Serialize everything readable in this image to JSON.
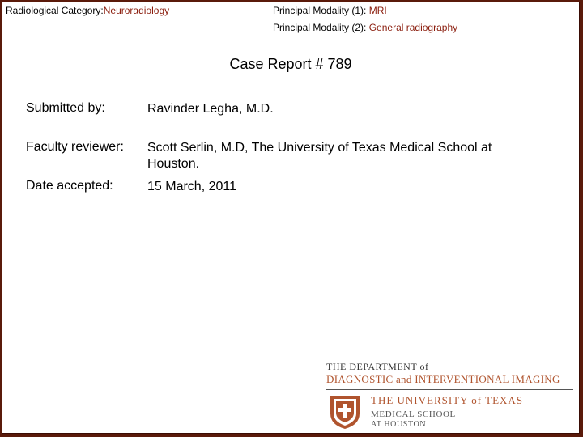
{
  "header": {
    "category_label": "Radiological Category:",
    "category_value": "Neuroradiology",
    "modality1_label": "Principal Modality (1):",
    "modality1_value": "MRI",
    "modality2_label": "Principal Modality (2):",
    "modality2_value": "General radiography"
  },
  "title": "Case Report # 789",
  "fields": {
    "submitted_label": "Submitted by:",
    "submitted_value": "Ravinder Legha, M.D.",
    "reviewer_label": "Faculty reviewer:",
    "reviewer_value": "Scott Serlin, M.D, The University of Texas Medical School at Houston.",
    "accepted_label": "Date accepted:",
    "accepted_value": "15 March, 2011"
  },
  "logo": {
    "dept_line1": "THE DEPARTMENT of",
    "dept_line2": "DIAGNOSTIC and INTERVENTIONAL IMAGING",
    "university": "THE UNIVERSITY of TEXAS",
    "school_line1": "MEDICAL SCHOOL",
    "school_line2": "AT HOUSTON",
    "brand_color": "#b0542e"
  }
}
